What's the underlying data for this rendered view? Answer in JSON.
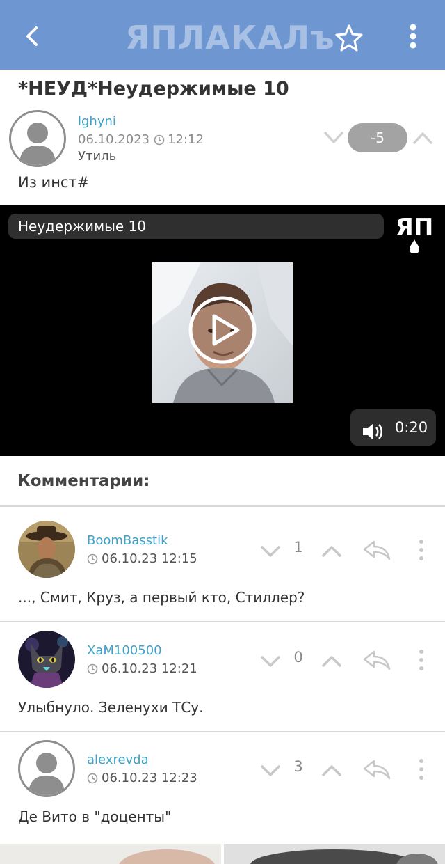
{
  "app": {
    "logo_text": "ЯПЛАКАЛъ",
    "back_icon": "chevron-left-icon",
    "favorite_icon": "star-outline-icon",
    "menu_icon": "vertical-dots-icon",
    "header_color": "#6e96d0"
  },
  "post": {
    "title": "*НЕУД*Неудержимые 10",
    "author": "lghyni",
    "date": "06.10.2023",
    "time": "12:12",
    "category": "Утиль",
    "rating": "-5",
    "text": "Из инст#"
  },
  "video": {
    "title": "Неудержимые 10",
    "duration": "0:20",
    "logo_text": "ЯП"
  },
  "comments_header": "Комментарии:",
  "comments": [
    {
      "author": "BoomBasstik",
      "time": "06.10.23 12:15",
      "score": "1",
      "text": "..., Смит, Круз, а первый кто, Стиллер?"
    },
    {
      "author": "XaM100500",
      "time": "06.10.23 12:21",
      "score": "0",
      "text": "Улыбнуло. Зеленухи ТСу."
    },
    {
      "author": "alexrevda",
      "time": "06.10.23 12:23",
      "score": "3",
      "text": "Де Вито в \"доценты\""
    }
  ],
  "colors": {
    "link": "#3ea1c8",
    "rating_pill": "#a3a3a3",
    "icon_gray": "#c8c8c8"
  }
}
